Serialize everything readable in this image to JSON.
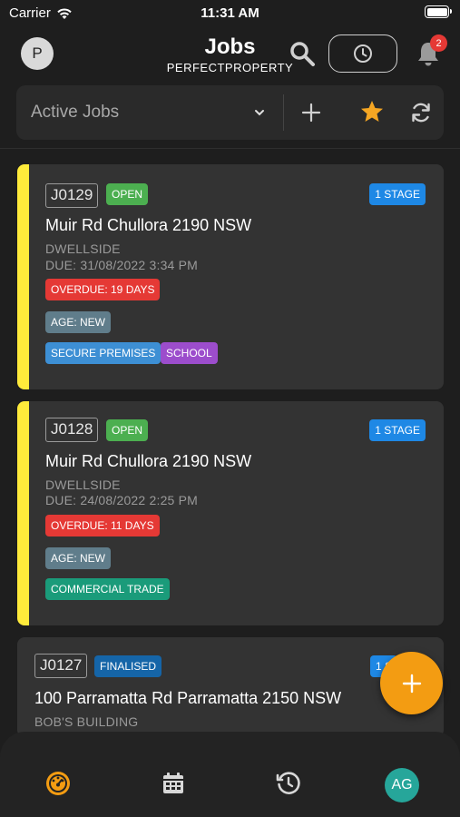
{
  "status_bar": {
    "carrier": "Carrier",
    "time": "11:31 AM"
  },
  "header": {
    "avatar_initial": "P",
    "title": "Jobs",
    "subtitle": "PERFECTPROPERTY",
    "notification_count": "2"
  },
  "filter": {
    "selected": "Active Jobs"
  },
  "jobs": [
    {
      "id": "J0129",
      "status": "OPEN",
      "stage": "1 STAGE",
      "address": "Muir Rd Chullora 2190 NSW",
      "client": "DWELLSIDE",
      "due": "DUE: 31/08/2022 3:34 PM",
      "overdue": "OVERDUE: 19 DAYS",
      "age": "AGE: NEW",
      "tags": [
        "SECURE PREMISES",
        "SCHOOL"
      ]
    },
    {
      "id": "J0128",
      "status": "OPEN",
      "stage": "1 STAGE",
      "address": "Muir Rd Chullora 2190 NSW",
      "client": "DWELLSIDE",
      "due": "DUE: 24/08/2022 2:25 PM",
      "overdue": "OVERDUE: 11 DAYS",
      "age": "AGE: NEW",
      "tags": [
        "COMMERCIAL TRADE"
      ]
    },
    {
      "id": "J0127",
      "status": "FINALISED",
      "stage": "1 S",
      "address": "100 Parramatta Rd Parramatta 2150 NSW",
      "client": "BOB'S BUILDING"
    }
  ],
  "bottom_nav": {
    "user_initials": "AG"
  },
  "colors": {
    "accent_yellow": "#ffeb3b",
    "open_green": "#4caf50",
    "stage_blue": "#1e88e5",
    "overdue_red": "#e53935",
    "age_gray": "#607d8b",
    "tag_blue": "#3d8fd4",
    "tag_purple": "#9c4dcc",
    "tag_teal": "#1a9b7a",
    "finalised_blue": "#1565a8",
    "fab_orange": "#f39c12"
  }
}
